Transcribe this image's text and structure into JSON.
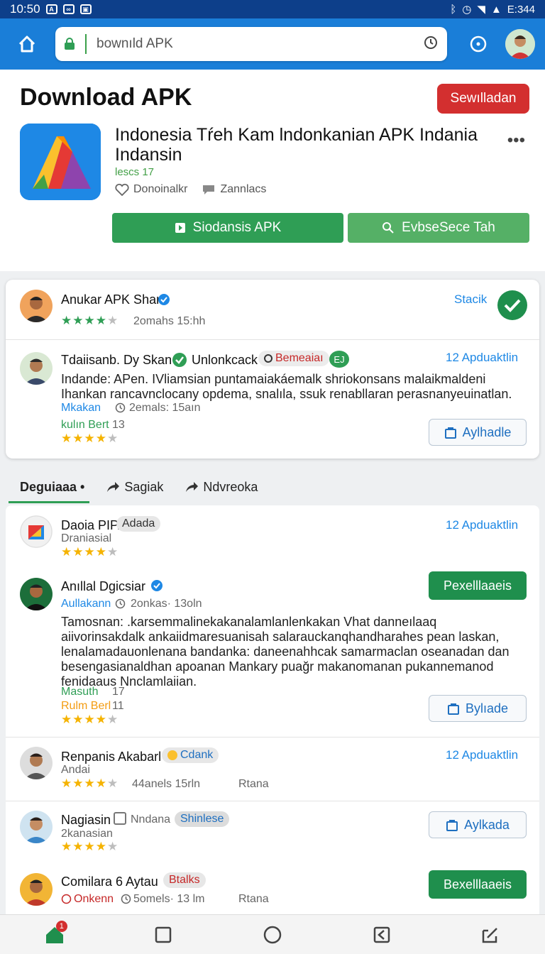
{
  "status_bar": {
    "time": "10:50",
    "right_text": "E:344"
  },
  "toolbar": {
    "url_text": "bownıld APK"
  },
  "header": {
    "title": "Download APK",
    "subscribe_label": "Sewılladan",
    "app_name": "Indonesia Tŕeh Kam lndonkanian APK Indania Indansin",
    "app_version": "lescs 17",
    "meta_like": "Donoinalkr",
    "meta_chat": "Zannlacs",
    "download_label": "Siodansis APK",
    "search_label": "EvbseSece Tah"
  },
  "card": {
    "r1": {
      "name": "Anukar APK Shan",
      "link": "Stacik",
      "time": "2omahs 15:hh"
    },
    "r2": {
      "name": "Tdaiisanb. Dy Skan",
      "verified_label": "Unlonkcack",
      "tag": "Bemeaiaı",
      "tag2": "EJ",
      "link": "12 Apduaktlin",
      "text": "Indande: APen. IVliamsian puntamaiakáemalk shriokonsans malaikmaldeni Ihankan rancavnclocany opdema, snalıla, ssuk renabllaran perasnanyeuinatlan.",
      "sub_a": "Mkakan",
      "sub_time": "2emals: 15aın",
      "sub_b": "kulın Bert",
      "sub_b_count": "13",
      "button": "Aylhadle"
    }
  },
  "tabs": {
    "t1": "Deguiaaa",
    "t2": "Sagiak",
    "t3": "Ndvreoka"
  },
  "list": {
    "i1": {
      "name": "Daoia PIP.",
      "tag": "Adada",
      "sub": "Draniasial",
      "link": "12 Apduaktlin"
    },
    "i2": {
      "name": "Anıllal Dgicsiar",
      "sub": "Aullakann",
      "time": "2onkas· 13oln",
      "button": "Pexelllaaeis",
      "text": "Tamosnan: .karsemmalinekakanalamlanlenkakan Vhat  danneılaaq aiivorinsakdalk ankaiidmaresuanisah salarauckanqhandharahes pean laskan, lenalamadauonlenana bandanka: daneenahhcak samarmaclan oseanadan dan besengasianaldhan apoanan Mankary puağr makanomanan pukannemanod fenidaaus Nnclamlaiian.",
      "sub_a": "Masuth",
      "sub_a_count": "17",
      "sub_b": "Rulm Berl",
      "sub_b_count": "11",
      "button2": "Bylıade"
    },
    "i3": {
      "name": "Renpanis Akabarl",
      "tag": "Cdank",
      "sub": "Andai",
      "time": "44anels 15rln",
      "extra": "Rtana",
      "link": "12 Apduaktlin"
    },
    "i4": {
      "name": "Nagiasin",
      "sub_tag": "Nndana",
      "tag": "Shinlese",
      "sub": "2kanasian",
      "button": "Aylkada"
    },
    "i5": {
      "name": "Comilara 6 Aytau",
      "tag": "Btalks",
      "sub": "Onkenn",
      "time": "5omels· 13 lm",
      "extra": "Rtana",
      "button": "Bexelllaaeis"
    }
  },
  "nav": {
    "badge": "1"
  },
  "colors": {
    "blue": "#1a7ed8",
    "green": "#2f9e55",
    "red": "#d32f2f",
    "star": "#f5b301"
  }
}
